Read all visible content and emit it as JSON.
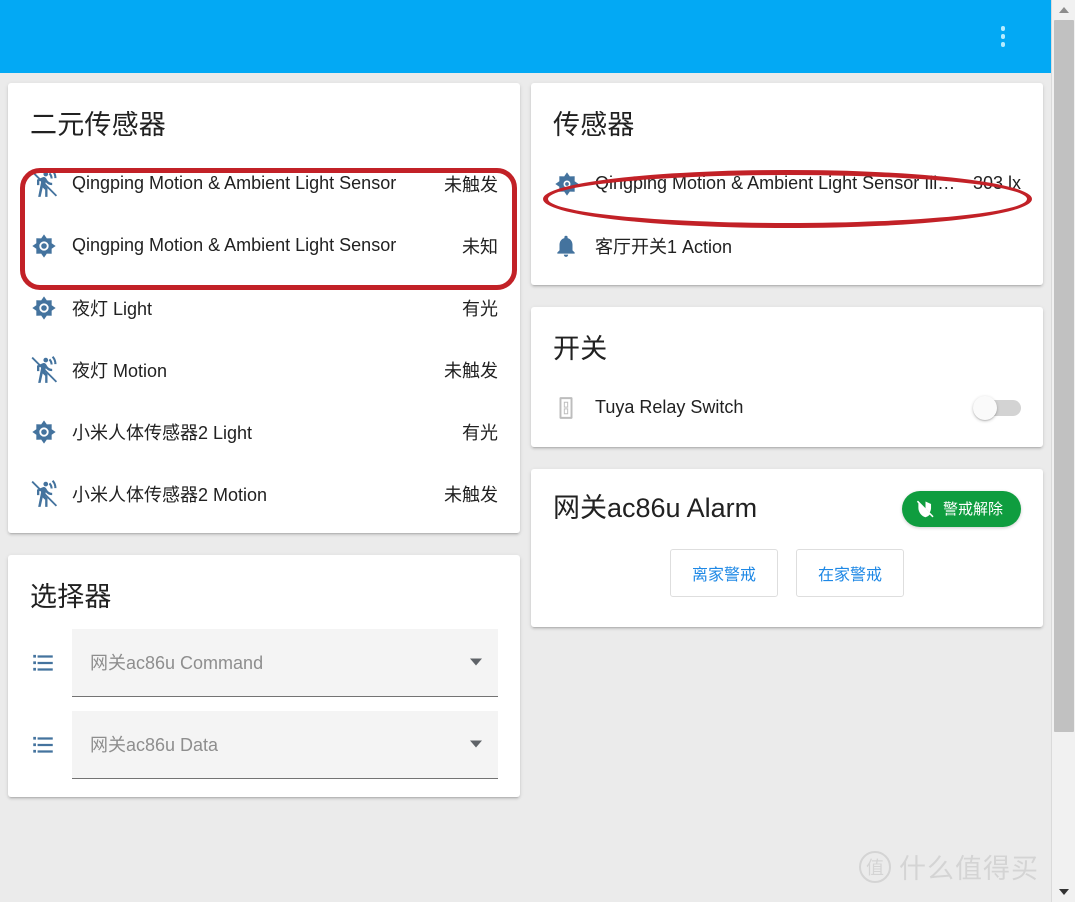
{
  "appbar": {
    "background_color": "#03a9f4",
    "overflow_menu": "more-vertical"
  },
  "columns": {
    "left": [
      {
        "id": "binary-sensor-card",
        "title": "二元传感器",
        "rows": [
          {
            "icon": "motion-sensor-off-icon",
            "name": "Qingping Motion & Ambient Light Sensor",
            "state": "未触发"
          },
          {
            "icon": "brightness-icon",
            "name": "Qingping Motion & Ambient Light Sensor",
            "state": "未知"
          },
          {
            "icon": "brightness-icon",
            "name": "夜灯 Light",
            "state": "有光"
          },
          {
            "icon": "motion-sensor-off-icon",
            "name": "夜灯 Motion",
            "state": "未触发"
          },
          {
            "icon": "brightness-icon",
            "name": "小米人体传感器2 Light",
            "state": "有光"
          },
          {
            "icon": "motion-sensor-off-icon",
            "name": "小米人体传感器2 Motion",
            "state": "未触发"
          }
        ]
      },
      {
        "id": "selector-card",
        "title": "选择器",
        "selectors": [
          {
            "icon": "format-list-bulleted-icon",
            "value": "网关ac86u Command",
            "caret": "chevron-down-icon"
          },
          {
            "icon": "format-list-bulleted-icon",
            "value": "网关ac86u Data",
            "caret": "chevron-down-icon"
          }
        ]
      }
    ],
    "right": [
      {
        "id": "sensor-card",
        "title": "传感器",
        "rows": [
          {
            "icon": "brightness-icon",
            "name": "Qingping Motion & Ambient Light Sensor Ill…",
            "state": "303 lx"
          },
          {
            "icon": "bell-icon",
            "name": "客厅开关1 Action",
            "state": ""
          }
        ]
      },
      {
        "id": "switch-card",
        "title": "开关",
        "rows": [
          {
            "icon": "light-switch-icon",
            "name": "Tuya Relay Switch",
            "toggle": "off"
          }
        ]
      },
      {
        "id": "alarm-card",
        "title": "网关ac86u Alarm",
        "disarm_button": {
          "icon": "shield-off-icon",
          "label": "警戒解除",
          "color": "#0f9d3f"
        },
        "mode_buttons": [
          {
            "label": "离家警戒"
          },
          {
            "label": "在家警戒"
          }
        ]
      }
    ]
  },
  "annotations": {
    "color": "#c22127",
    "left_box": "highlight-binary-sensor-rows",
    "right_ellipse": "highlight-illuminance-row"
  },
  "scrollbar": {
    "up_arrow": "caret-up-icon",
    "down_arrow": "caret-down-icon"
  },
  "watermark": {
    "badge": "值",
    "text": "什么值得买"
  }
}
